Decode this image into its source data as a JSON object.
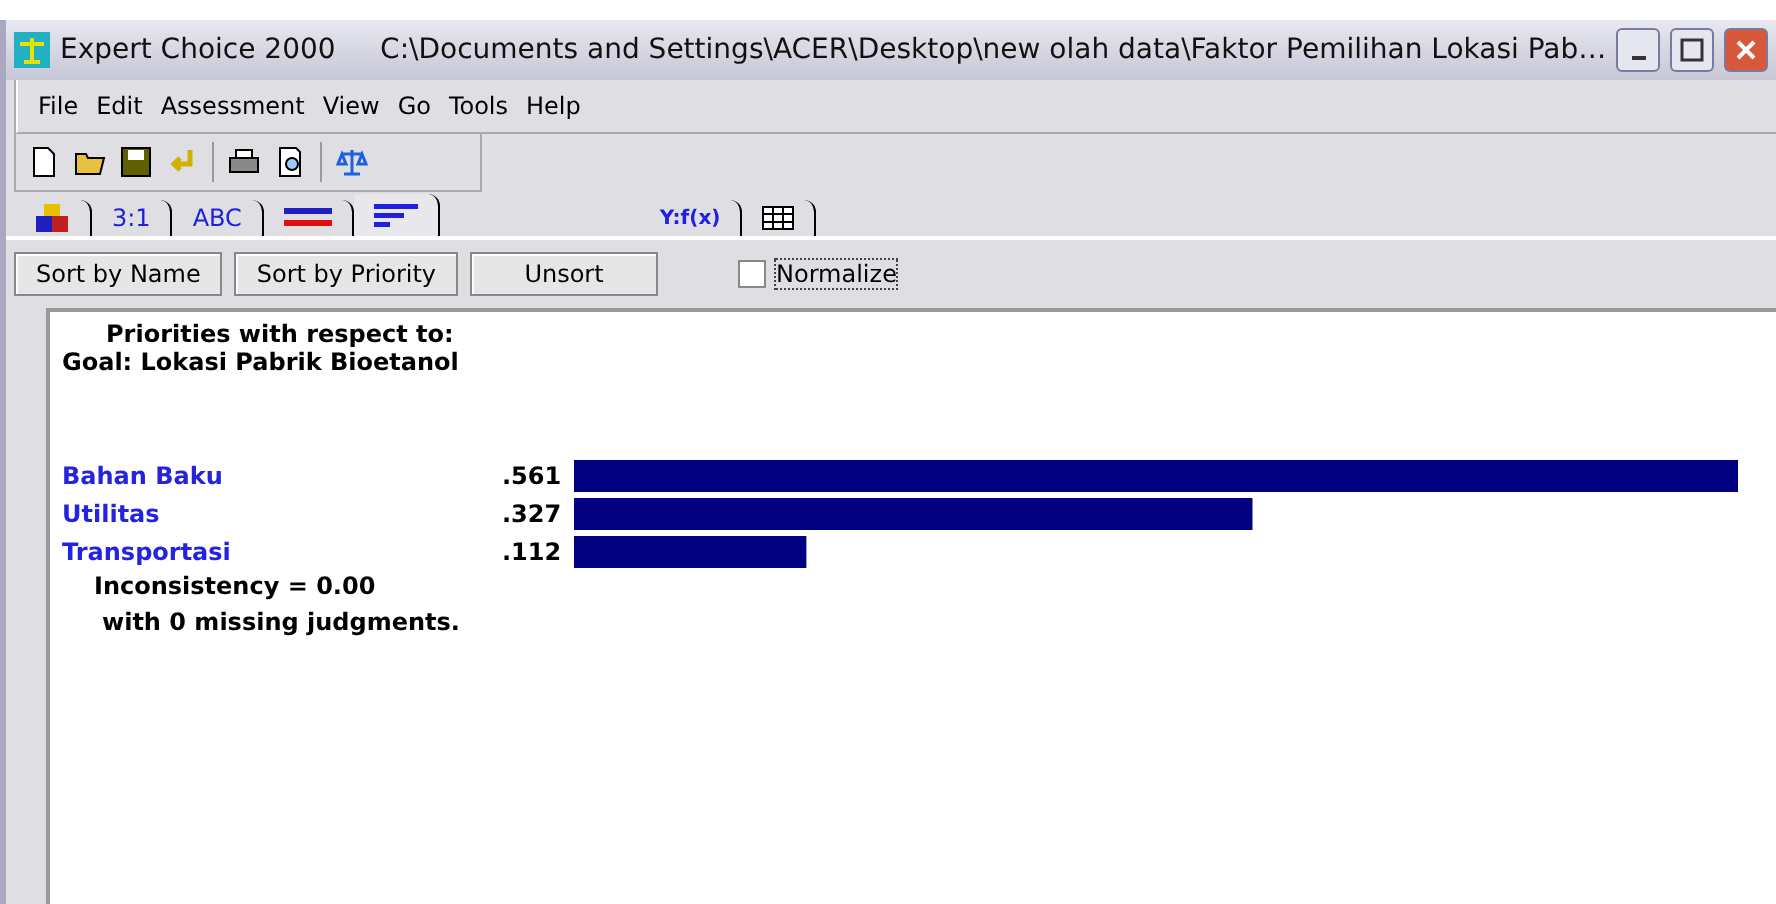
{
  "window": {
    "title": "Expert Choice 2000     C:\\Documents and Settings\\ACER\\Desktop\\new olah data\\Faktor Pemilihan Lokasi Pab…"
  },
  "menu": [
    "File",
    "Edit",
    "Assessment",
    "View",
    "Go",
    "Tools",
    "Help"
  ],
  "tabs": [
    {
      "kind": "cubes",
      "selected": false
    },
    {
      "kind": "text",
      "label": "3:1",
      "selected": false
    },
    {
      "kind": "text",
      "label": "ABC",
      "selected": false
    },
    {
      "kind": "bars",
      "selected": false
    },
    {
      "kind": "lines",
      "selected": true
    },
    {
      "kind": "formula",
      "label": "Y:f(x)",
      "selected": false
    },
    {
      "kind": "grid",
      "selected": false
    }
  ],
  "buttons": [
    "Sort by Name",
    "Sort by Priority",
    "Unsort"
  ],
  "normalize": {
    "label": "Normalize",
    "checked": false
  },
  "heading": "Priorities with respect to:",
  "goal": "Goal: Lokasi Pabrik Bioetanol",
  "priorities": {
    "chart_data": {
      "type": "bar",
      "orientation": "horizontal",
      "categories": [
        "Bahan Baku",
        "Utilitas",
        "Transportasi"
      ],
      "values": [
        0.561,
        0.327,
        0.112
      ],
      "value_labels": [
        ".561",
        ".327",
        ".112"
      ]
    }
  },
  "inconsistency": "Inconsistency = 0.00",
  "missing": "with 0  missing judgments."
}
